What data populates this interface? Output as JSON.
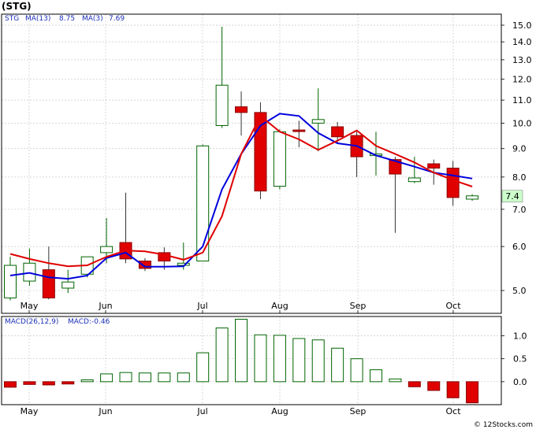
{
  "header": {
    "ticker": "(STG)",
    "legend_symbol": "STG",
    "ma13_label": "MA(13)",
    "ma13_value": "8.75",
    "ma3_label": "MA(3)",
    "ma3_value": "7.69",
    "macd_label": "MACD(26,12,9)",
    "macd_value_label": "MACD:-0.46"
  },
  "last_price_tag": "7.4",
  "footer": {
    "copyright": "© 12Stocks.com"
  },
  "colors": {
    "up_candle_stroke": "#006400",
    "down_candle_fill": "#e00000",
    "ma13": "#0000dd",
    "ma3": "#e00000",
    "grid": "#c8c8c8",
    "border": "#000000",
    "price_tag_bg": "#ccffcc",
    "legend_text": "#1a2eb8"
  },
  "chart_data": [
    {
      "type": "candlestick",
      "title": "STG",
      "scale": "log",
      "ylim": [
        4.55,
        15.7
      ],
      "yticks": [
        "5.0",
        "6.0",
        "7.0",
        "8.0",
        "9.0",
        "10.0",
        "11.0",
        "12.0",
        "13.0",
        "14.0",
        "15.0"
      ],
      "xticks": [
        "May",
        "Jun",
        "Jul",
        "Aug",
        "Sep",
        "Oct"
      ],
      "grid": true,
      "candles": [
        {
          "x": "Apr-W5",
          "open": 4.85,
          "close": 5.55,
          "high": 5.75,
          "low": 4.8
        },
        {
          "x": "May-W1",
          "open": 5.2,
          "close": 5.6,
          "high": 5.95,
          "low": 5.1
        },
        {
          "x": "May-W2",
          "open": 5.45,
          "close": 4.85,
          "high": 6.0,
          "low": 4.82
        },
        {
          "x": "May-W3",
          "open": 5.05,
          "close": 5.18,
          "high": 5.45,
          "low": 4.95
        },
        {
          "x": "May-W4",
          "open": 5.35,
          "close": 5.75,
          "high": 5.75,
          "low": 5.28
        },
        {
          "x": "Jun-W1",
          "open": 5.85,
          "close": 6.0,
          "high": 6.75,
          "low": 5.6
        },
        {
          "x": "Jun-W2",
          "open": 6.1,
          "close": 5.7,
          "high": 7.5,
          "low": 5.6
        },
        {
          "x": "Jun-W3",
          "open": 5.65,
          "close": 5.48,
          "high": 5.72,
          "low": 5.42
        },
        {
          "x": "Jun-W4",
          "open": 5.85,
          "close": 5.65,
          "high": 5.98,
          "low": 5.45
        },
        {
          "x": "Jun-W5",
          "open": 5.55,
          "close": 5.6,
          "high": 6.1,
          "low": 5.45
        },
        {
          "x": "Jul-W1",
          "open": 5.65,
          "close": 9.1,
          "high": 9.15,
          "low": 5.65
        },
        {
          "x": "Jul-W2",
          "open": 9.9,
          "close": 11.7,
          "high": 14.9,
          "low": 9.8
        },
        {
          "x": "Jul-W3",
          "open": 10.7,
          "close": 10.45,
          "high": 11.4,
          "low": 9.5
        },
        {
          "x": "Jul-W4",
          "open": 10.45,
          "close": 7.55,
          "high": 10.9,
          "low": 7.3
        },
        {
          "x": "Aug-W1",
          "open": 7.7,
          "close": 9.65,
          "high": 9.75,
          "low": 7.6
        },
        {
          "x": "Aug-W2",
          "open": 9.72,
          "close": 9.68,
          "high": 10.1,
          "low": 9.05
        },
        {
          "x": "Aug-W3",
          "open": 10.0,
          "close": 10.15,
          "high": 11.55,
          "low": 8.9
        },
        {
          "x": "Aug-W4",
          "open": 9.85,
          "close": 9.45,
          "high": 10.05,
          "low": 9.2
        },
        {
          "x": "Sep-W1",
          "open": 9.5,
          "close": 8.7,
          "high": 9.65,
          "low": 8.0
        },
        {
          "x": "Sep-W2",
          "open": 8.75,
          "close": 8.8,
          "high": 9.65,
          "low": 8.05
        },
        {
          "x": "Sep-W3",
          "open": 8.6,
          "close": 8.1,
          "high": 8.7,
          "low": 6.35
        },
        {
          "x": "Sep-W4",
          "open": 7.85,
          "close": 7.97,
          "high": 8.7,
          "low": 7.8
        },
        {
          "x": "Oct-W1",
          "open": 8.45,
          "close": 8.3,
          "high": 8.6,
          "low": 7.75
        },
        {
          "x": "Oct-W2",
          "open": 8.3,
          "close": 7.35,
          "high": 8.55,
          "low": 7.1
        },
        {
          "x": "Oct-W3",
          "open": 7.3,
          "close": 7.4,
          "high": 7.45,
          "low": 7.25
        }
      ],
      "series": [
        {
          "name": "MA(13)",
          "values": [
            5.32,
            5.38,
            5.28,
            5.25,
            5.32,
            5.72,
            5.85,
            5.52,
            5.52,
            5.53,
            6.0,
            7.6,
            8.8,
            9.9,
            10.4,
            10.3,
            9.6,
            9.2,
            9.1,
            8.75,
            8.55,
            8.35,
            8.15,
            8.05,
            7.95
          ]
        },
        {
          "name": "MA(3)",
          "values": [
            5.82,
            5.7,
            5.6,
            5.53,
            5.55,
            5.75,
            5.9,
            5.88,
            5.8,
            5.68,
            5.85,
            6.8,
            8.8,
            10.3,
            9.65,
            9.35,
            8.95,
            9.3,
            9.7,
            9.1,
            8.8,
            8.5,
            8.15,
            7.9,
            7.69
          ]
        }
      ]
    },
    {
      "type": "bar",
      "title": "MACD(26,12,9)",
      "ylim": [
        -0.5,
        1.42
      ],
      "yticks": [
        "0.0",
        "0.5",
        "1.0"
      ],
      "xticks": [
        "May",
        "Jun",
        "Jul",
        "Aug",
        "Sep",
        "Oct"
      ],
      "grid": true,
      "values": [
        -0.12,
        -0.06,
        -0.07,
        -0.05,
        0.04,
        0.17,
        0.2,
        0.19,
        0.19,
        0.19,
        0.63,
        1.17,
        1.36,
        1.02,
        1.01,
        0.94,
        0.91,
        0.73,
        0.5,
        0.26,
        0.06,
        -0.11,
        -0.19,
        -0.35,
        -0.46
      ]
    }
  ]
}
